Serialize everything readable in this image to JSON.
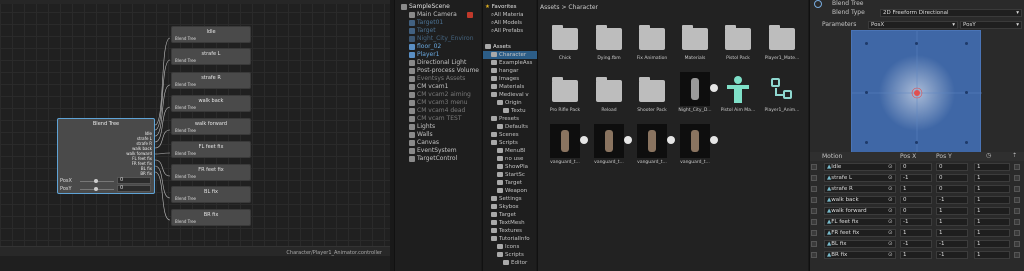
{
  "graph": {
    "nodes": [
      {
        "name": "Idle",
        "sub": "Blend Tree"
      },
      {
        "name": "strafe L",
        "sub": "Blend Tree"
      },
      {
        "name": "strafe R",
        "sub": "Blend Tree"
      },
      {
        "name": "walk back",
        "sub": "Blend Tree"
      },
      {
        "name": "walk forward",
        "sub": "Blend Tree"
      },
      {
        "name": "FL feet fix",
        "sub": "Blend Tree"
      },
      {
        "name": "FR feet fix",
        "sub": "Blend Tree"
      },
      {
        "name": "BL fix",
        "sub": "Blend Tree"
      },
      {
        "name": "BR fix",
        "sub": "Blend Tree"
      }
    ],
    "main_node": {
      "title": "Blend Tree",
      "ports": [
        "Idle",
        "strafe L",
        "strafe R",
        "walk back",
        "walk forward",
        "FL feet fix",
        "FR feet fix",
        "BL fix",
        "BR fix"
      ],
      "params": [
        {
          "name": "PosX",
          "value": "0"
        },
        {
          "name": "PosY",
          "value": "0"
        }
      ]
    },
    "footer_path": "Character/Player1_Animator.controller"
  },
  "hierarchy": {
    "items": [
      {
        "label": "SampleScene",
        "style": "bold"
      },
      {
        "label": "Main Camera",
        "style": ""
      },
      {
        "label": "Target01",
        "style": "blue"
      },
      {
        "label": "Target",
        "style": "blue"
      },
      {
        "label": "Night_City_Environ",
        "style": "blue"
      },
      {
        "label": "floor_02",
        "style": "blue"
      },
      {
        "label": "Player1",
        "style": "blue"
      },
      {
        "label": "Directional Light",
        "style": ""
      },
      {
        "label": "Post-process Volume",
        "style": ""
      },
      {
        "label": "Eventsys Assets",
        "style": "dim"
      },
      {
        "label": "CM vcam1",
        "style": ""
      },
      {
        "label": "CM vcam2 aiming",
        "style": "dim"
      },
      {
        "label": "CM vcam3 menu",
        "style": "dim"
      },
      {
        "label": "CM vcam4 dead",
        "style": "dim"
      },
      {
        "label": "CM vcam TEST",
        "style": "dim"
      },
      {
        "label": "Lights",
        "style": ""
      },
      {
        "label": "Walls",
        "style": ""
      },
      {
        "label": "Canvas",
        "style": ""
      },
      {
        "label": "EventSystem",
        "style": ""
      },
      {
        "label": "TargetControl",
        "style": ""
      }
    ]
  },
  "project": {
    "favorites": "Favorites",
    "fav_items": [
      "All Materia",
      "All Models",
      "All Prefabs"
    ],
    "assets": "Assets",
    "items": [
      "Character",
      "ExampleAss",
      "hangar",
      "Images",
      "Materials",
      "Medieval v",
      "Origin",
      "Textu",
      "Presets",
      "Defaults",
      "Scenes",
      "Scripts",
      "MenuBl",
      "no use",
      "ShowPla",
      "StartSc",
      "Target",
      "Weapon",
      "Settings",
      "Skybox",
      "Target",
      "TextMesh",
      "Textures",
      "TutorialInfo",
      "Icons",
      "Scripts",
      "Editor"
    ]
  },
  "assets": {
    "breadcrumb_root": "Assets",
    "breadcrumb_sep": ">",
    "breadcrumb_current": "Character",
    "tiles": [
      {
        "label": "Chick",
        "kind": "folder"
      },
      {
        "label": "Dying.fbm",
        "kind": "folder"
      },
      {
        "label": "Fix Animation",
        "kind": "folder"
      },
      {
        "label": "Materials",
        "kind": "folder"
      },
      {
        "label": "Pistol Pack",
        "kind": "folder"
      },
      {
        "label": "Player1_Mate...",
        "kind": "folder"
      },
      {
        "label": "Pro Rifle Pack",
        "kind": "folder"
      },
      {
        "label": "Reload",
        "kind": "folder"
      },
      {
        "label": "Shooter Pack",
        "kind": "folder"
      },
      {
        "label": "Night_City_D...",
        "kind": "model"
      },
      {
        "label": "Pistol Aim Ma...",
        "kind": "avatar"
      },
      {
        "label": "Player1_Anim...",
        "kind": "controller"
      },
      {
        "label": "vanguard_t...",
        "kind": "model"
      },
      {
        "label": "vanguard_t...",
        "kind": "model"
      },
      {
        "label": "vanguard_t...",
        "kind": "model"
      },
      {
        "label": "vanguard_t...",
        "kind": "model"
      }
    ]
  },
  "inspector": {
    "title": "Blend Tree",
    "blend_type_label": "Blend Type",
    "blend_type_value": "2D Freeform Directional",
    "parameters_label": "Parameters",
    "param_x": "PosX",
    "param_y": "PosY",
    "motion_header": "Motion",
    "posx_header": "Pos X",
    "posy_header": "Pos Y",
    "motions": [
      {
        "name": "Idle",
        "x": "0",
        "y": "0",
        "speed": "1"
      },
      {
        "name": "strafe L",
        "x": "-1",
        "y": "0",
        "speed": "1"
      },
      {
        "name": "strafe R",
        "x": "1",
        "y": "0",
        "speed": "1"
      },
      {
        "name": "walk back",
        "x": "0",
        "y": "-1",
        "speed": "1"
      },
      {
        "name": "walk forward",
        "x": "0",
        "y": "1",
        "speed": "1"
      },
      {
        "name": "FL feet fix",
        "x": "-1",
        "y": "1",
        "speed": "1"
      },
      {
        "name": "FR feet fix",
        "x": "1",
        "y": "1",
        "speed": "1"
      },
      {
        "name": "BL fix",
        "x": "-1",
        "y": "-1",
        "speed": "1"
      },
      {
        "name": "BR fix",
        "x": "1",
        "y": "-1",
        "speed": "1"
      }
    ],
    "colors": {
      "blend_area": "#3f67a6",
      "selected": "#2c5d87"
    }
  }
}
